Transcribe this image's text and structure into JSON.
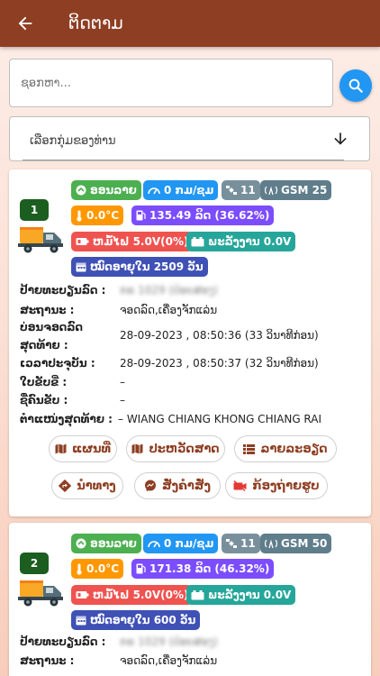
{
  "header": {
    "title": "ຕິດຕາມ"
  },
  "search": {
    "placeholder": "ຊອກຫາ..."
  },
  "group_select": {
    "label": "ເລືອກກຸ່ມຂອງທ່ານ"
  },
  "labels": {
    "plate": "ປ້າຍທະບຽນລົດ :",
    "status": "ສະຖານະ :",
    "last_park_1": "ບ່ອນຈອດລົດ",
    "last_park_2": "ສຸດທ້າຍ :",
    "current_time": "ເວລາປະຈຸບັນ :",
    "license": "ໃບຂັບຂີ່ :",
    "driver": "ຊື່ຄົນຂັບ :",
    "last_location": "ຕຳແໜ່ງສຸດທ້າຍ :"
  },
  "actions": {
    "map": "ແຜນທີ່",
    "history": "ປະຫວັດສາດ",
    "details": "ລາຍລະອຽດ",
    "navigate": "ນຳທາງ",
    "command": "ສັ່ງຄຳສັ່ງ",
    "camera": "ກ້ອງຖ່າຍຮູບ"
  },
  "vehicles": [
    {
      "index": "1",
      "online": "ອອນລາຍ",
      "speed": "0 ກມ/ຊມ",
      "satellites": "11",
      "gsm": "GSM 25",
      "temperature": "0.0°C",
      "fuel": "135.49 ລິດ (36.62%)",
      "battery": "ຫມໍ້ໄຟ 5.0V(0%)",
      "power": "ພະລັງງານ 0.0V",
      "lifetime": "ໝົດອາຍຸໃນ 2509 ວັນ",
      "plate": "ກຂ 1029 (ປ່ອຍສອງ)",
      "status": "ຈອດລົດ,ເຄື່ອງຈັກແລ່ນ",
      "last_park": "28-09-2023 , 08:50:36 (33 ວິນາທີກ່ອນ)",
      "current_time": "28-09-2023 , 08:50:37 (32 ວິນາທີກ່ອນ)",
      "license": "–",
      "driver": "–",
      "last_location": "– WIANG CHIANG KHONG CHIANG RAI"
    },
    {
      "index": "2",
      "online": "ອອນລາຍ",
      "speed": "0 ກມ/ຊມ",
      "satellites": "11",
      "gsm": "GSM 50",
      "temperature": "0.0°C",
      "fuel": "171.38 ລິດ (46.32%)",
      "battery": "ຫມໍ້ໄຟ 5.0V(0%)",
      "power": "ພະລັງງານ 0.0V",
      "lifetime": "ໝົດອາຍຸໃນ 600 ວັນ",
      "plate": "ກຂ 1029 (ປ່ອຍສອງ)",
      "status": "ຈອດລົດ,ເຄື່ອງຈັກແລ່ນ"
    }
  ],
  "colors": {
    "appbar": "#8e3e22",
    "online": "#4caf50",
    "speed": "#2196f3",
    "satellite": "#78909c",
    "gsm": "#607d8b",
    "temperature": "#ff9800",
    "fuel": "#7c4dff",
    "battery": "#ef5350",
    "power": "#26a69a",
    "lifetime": "#3f51b5",
    "search_button": "#2196f3"
  }
}
